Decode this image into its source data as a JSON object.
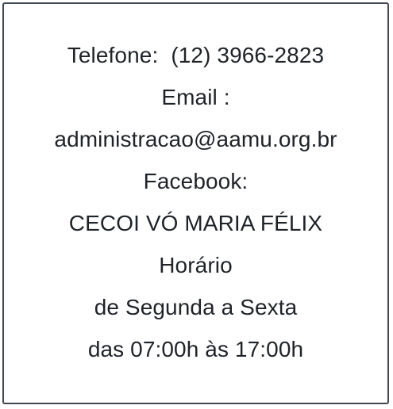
{
  "contact": {
    "telefone_label": "Telefone:",
    "telefone_value": "(12) 3966-2823",
    "email_label": "Email :",
    "email_value": "administracao@aamu.org.br",
    "facebook_label": "Facebook:",
    "facebook_value": "CECOI VÓ MARIA FÉLIX"
  },
  "schedule": {
    "title": "Horário",
    "days": "de Segunda a Sexta",
    "hours": "das 07:00h às 17:00h"
  }
}
